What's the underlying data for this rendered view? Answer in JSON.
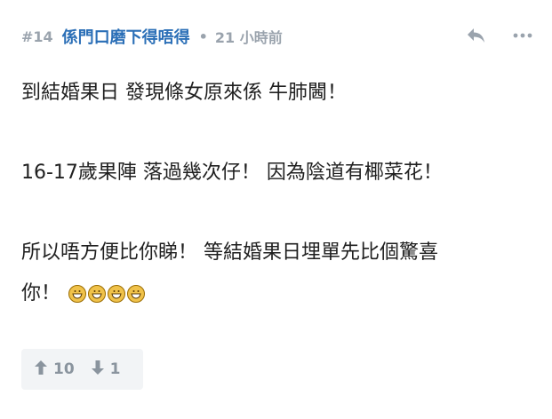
{
  "header": {
    "floor": "#14",
    "username": "係門口磨下得唔得",
    "separator": "•",
    "time": "21 小時前"
  },
  "icons": {
    "reply": "reply-arrow-icon",
    "more": "more-dots-icon",
    "upvote": "arrow-up-icon",
    "downvote": "arrow-down-icon",
    "emoji": "grinning-face-icon"
  },
  "post": {
    "line1": "到結婚果日 發現條女原來係 牛肺閪！",
    "line2": "16-17歲果陣 落過幾次仔！ 因為陰道有椰菜花！",
    "line3": "所以唔方便比你睇！ 等結婚果日埋單先比個驚喜",
    "line4": "你！"
  },
  "votes": {
    "up": "10",
    "down": "1"
  },
  "colors": {
    "username": "#2b6fb7",
    "muted": "#9aa3ad",
    "vote_bg": "#f2f4f6"
  }
}
